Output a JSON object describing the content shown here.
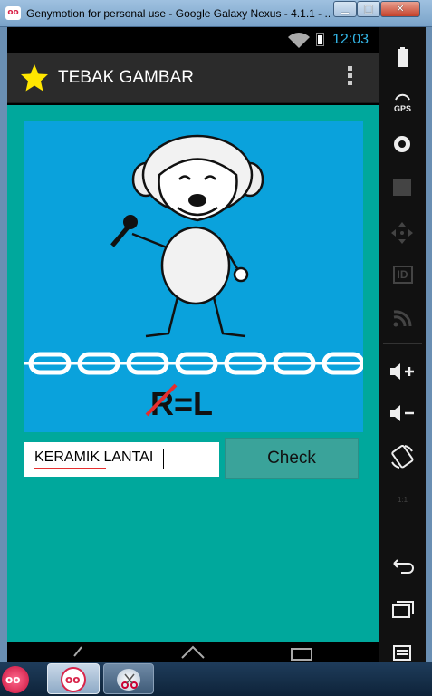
{
  "window": {
    "title": "Genymotion for personal use - Google Galaxy Nexus - 4.1.1 - ...",
    "min_label": "▁",
    "max_label": "□",
    "close_label": "✕"
  },
  "statusbar": {
    "time": "12:03"
  },
  "actionbar": {
    "title": "TEBAK GAMBAR",
    "icon": "star-icon",
    "overflow_icon": "overflow-menu-icon"
  },
  "puzzle": {
    "hint_text": "R=L",
    "struck_letter": "R"
  },
  "answer": {
    "value": "KERAMIK LANTAI"
  },
  "check": {
    "label": "Check"
  },
  "colors": {
    "content_bg": "#00a89c",
    "puzzle_bg": "#0aa2dc",
    "button_bg": "#3aa39a",
    "accent_time": "#33b5e5"
  },
  "sidepanel": {
    "items": [
      "battery-icon",
      "gps-icon",
      "webcam-icon",
      "video-icon",
      "dpad-icon",
      "id-icon",
      "rss-icon",
      "volume-up-icon",
      "volume-down-icon",
      "rotate-icon",
      "scale-icon",
      "back-icon",
      "recent-apps-icon",
      "menu-icon"
    ],
    "gps_label": "GPS",
    "id_label": "ID",
    "scale_label": "1:1"
  },
  "taskbar": {
    "items": [
      "start-orb",
      "genymotion-task",
      "snipping-tool-task"
    ]
  }
}
